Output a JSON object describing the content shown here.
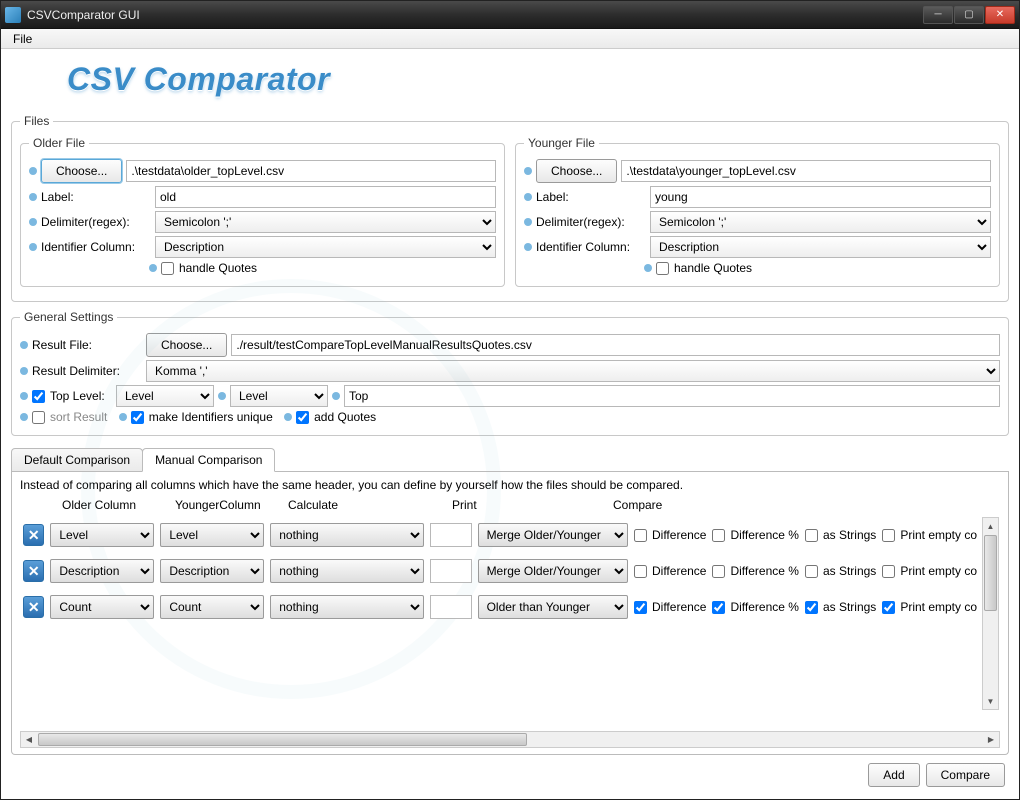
{
  "window": {
    "title": "CSVComparator GUI"
  },
  "menubar": {
    "file": "File"
  },
  "logo": "CSV Comparator",
  "files": {
    "legend": "Files",
    "older": {
      "legend": "Older File",
      "choose": "Choose...",
      "path": ".\\testdata\\older_topLevel.csv",
      "label_lbl": "Label:",
      "label_val": "old",
      "delim_lbl": "Delimiter(regex):",
      "delim_val": "Semicolon ';'",
      "ident_lbl": "Identifier Column:",
      "ident_val": "Description",
      "hq_lbl": "handle Quotes"
    },
    "younger": {
      "legend": "Younger File",
      "choose": "Choose...",
      "path": ".\\testdata\\younger_topLevel.csv",
      "label_lbl": "Label:",
      "label_val": "young",
      "delim_lbl": "Delimiter(regex):",
      "delim_val": "Semicolon ';'",
      "ident_lbl": "Identifier Column:",
      "ident_val": "Description",
      "hq_lbl": "handle Quotes"
    }
  },
  "general": {
    "legend": "General Settings",
    "result_file_lbl": "Result File:",
    "result_choose": "Choose...",
    "result_path": "./result/testCompareTopLevelManualResultsQuotes.csv",
    "result_delim_lbl": "Result Delimiter:",
    "result_delim_val": "Komma ','",
    "toplevel_lbl": "Top Level:",
    "toplevel_sel1": "Level",
    "toplevel_sel2": "Level",
    "toplevel_txt": "Top",
    "sort_lbl": "sort Result",
    "uniq_lbl": "make Identifiers unique",
    "quotes_lbl": "add Quotes"
  },
  "tabs": {
    "default": "Default Comparison",
    "manual": "Manual Comparison"
  },
  "manual": {
    "desc": "Instead of comparing all columns which have the same header, you can define by yourself how the files should be compared.",
    "hdr": {
      "older": "Older Column",
      "younger": "YoungerColumn",
      "calc": "Calculate",
      "print": "Print",
      "compare": "Compare"
    },
    "rows": [
      {
        "older": "Level",
        "younger": "Level",
        "calc": "nothing",
        "print": "Merge Older/Younger",
        "diff": false,
        "diffpct": false,
        "asstr": false,
        "pempty": false
      },
      {
        "older": "Description",
        "younger": "Description",
        "calc": "nothing",
        "print": "Merge Older/Younger",
        "diff": false,
        "diffpct": false,
        "asstr": false,
        "pempty": false
      },
      {
        "older": "Count",
        "younger": "Count",
        "calc": "nothing",
        "print": "Older than Younger",
        "diff": true,
        "diffpct": true,
        "asstr": true,
        "pempty": true
      }
    ],
    "chk_diff": "Difference",
    "chk_diffpct": "Difference %",
    "chk_asstr": "as Strings",
    "chk_pempty": "Print empty co"
  },
  "bottom": {
    "add": "Add",
    "compare": "Compare"
  }
}
